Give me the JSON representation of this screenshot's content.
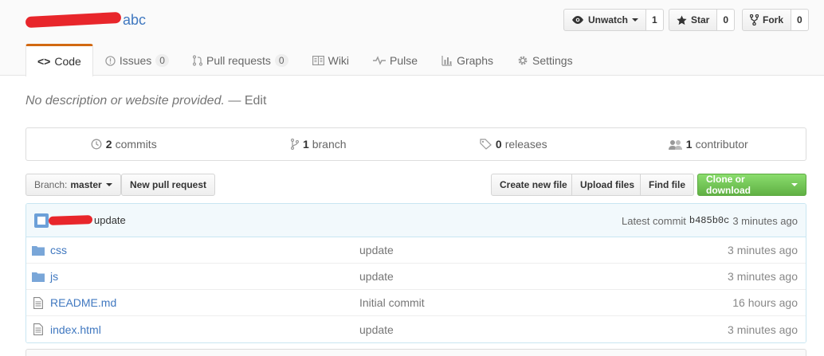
{
  "repo": {
    "name": "abc"
  },
  "actions": {
    "watch": {
      "label": "Unwatch",
      "count": "1"
    },
    "star": {
      "label": "Star",
      "count": "0"
    },
    "fork": {
      "label": "Fork",
      "count": "0"
    }
  },
  "tabs": [
    {
      "label": "Code",
      "icon": "code-icon",
      "selected": true
    },
    {
      "label": "Issues",
      "icon": "issue-icon",
      "count": "0"
    },
    {
      "label": "Pull requests",
      "icon": "pull-request-icon",
      "count": "0"
    },
    {
      "label": "Wiki",
      "icon": "book-icon"
    },
    {
      "label": "Pulse",
      "icon": "pulse-icon"
    },
    {
      "label": "Graphs",
      "icon": "graph-icon"
    },
    {
      "label": "Settings",
      "icon": "gear-icon"
    }
  ],
  "description": {
    "text": "No description or website provided.",
    "separator": "—",
    "edit": "Edit"
  },
  "summary": {
    "commits": {
      "num": "2",
      "label": "commits"
    },
    "branch": {
      "num": "1",
      "label": "branch"
    },
    "releases": {
      "num": "0",
      "label": "releases"
    },
    "contributor": {
      "num": "1",
      "label": "contributor"
    }
  },
  "file_nav": {
    "branch_prefix": "Branch:",
    "branch_name": "master",
    "new_pr": "New pull request",
    "create_file": "Create new file",
    "upload_files": "Upload files",
    "find_file": "Find file",
    "clone": "Clone or download"
  },
  "latest_commit": {
    "message": "update",
    "prefix": "Latest commit",
    "sha": "b485b0c",
    "age": "3 minutes ago"
  },
  "files": [
    {
      "name": "css",
      "type": "folder",
      "message": "update",
      "age": "3 minutes ago"
    },
    {
      "name": "js",
      "type": "folder",
      "message": "update",
      "age": "3 minutes ago"
    },
    {
      "name": "README.md",
      "type": "file",
      "message": "Initial commit",
      "age": "16 hours ago"
    },
    {
      "name": "index.html",
      "type": "file",
      "message": "update",
      "age": "3 minutes ago"
    }
  ],
  "colors": {
    "link": "#4078c0",
    "accent_tab": "#d26911",
    "clone_green": "#60b044",
    "redaction": "#e8262b"
  }
}
